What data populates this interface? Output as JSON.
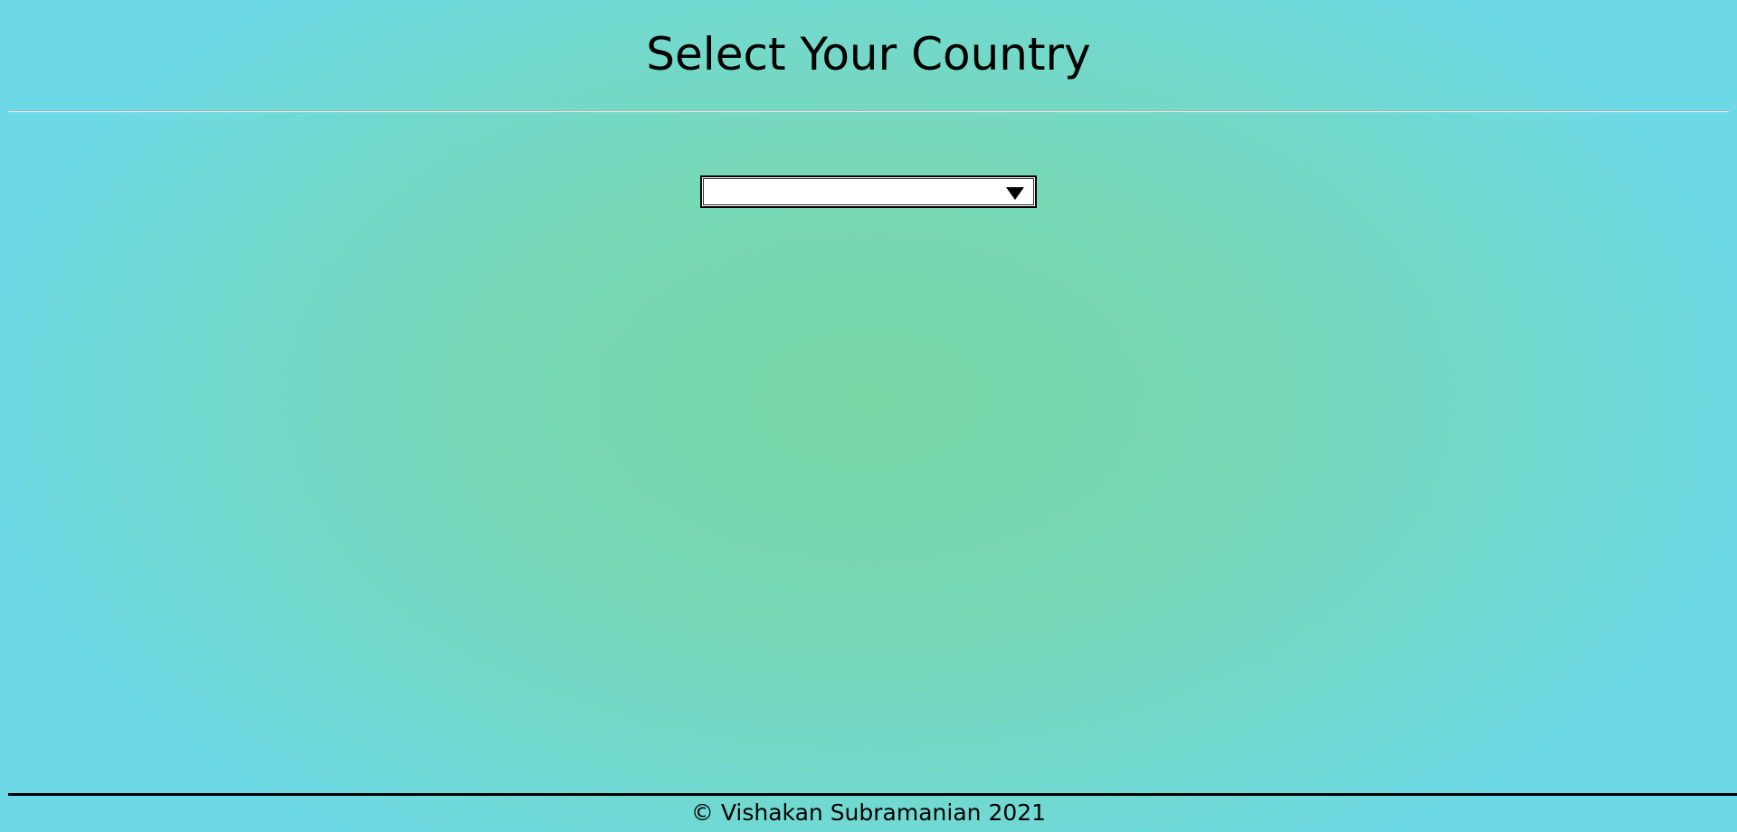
{
  "page": {
    "title": "Select Your Country"
  },
  "country_select": {
    "selected_value": ""
  },
  "footer": {
    "copyright": "© Vishakan Subramanian 2021"
  },
  "colors": {
    "background_center": "#79d6a6",
    "background_edge": "#6dd9e6",
    "text": "#000000"
  },
  "icons": {
    "dropdown": "chevron-down-icon"
  }
}
